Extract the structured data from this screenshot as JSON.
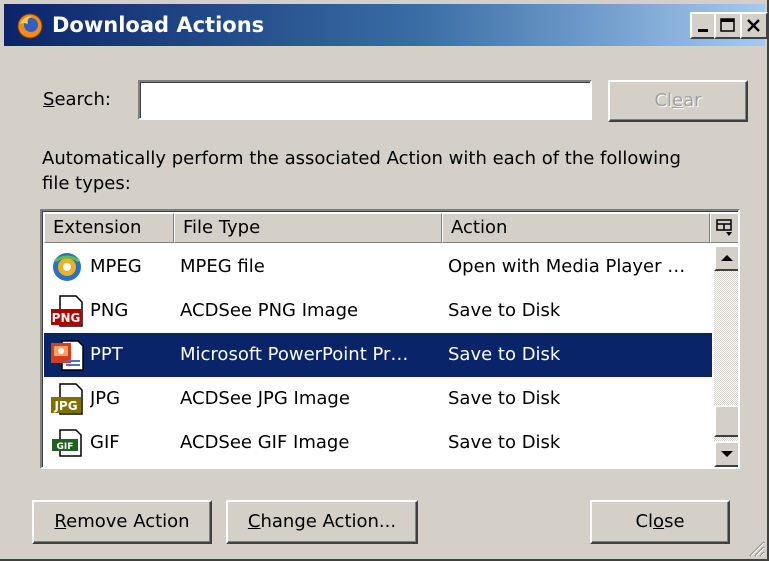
{
  "window": {
    "title": "Download Actions",
    "icon": "firefox-icon"
  },
  "title_buttons": {
    "minimize": "minimize-icon",
    "maximize": "maximize-icon",
    "close": "close-icon"
  },
  "search": {
    "label_accel": "S",
    "label_rest": "earch:",
    "value": "",
    "placeholder": "",
    "clear_pre": "Cl",
    "clear_accel": "e",
    "clear_post": "ar"
  },
  "description": {
    "line1": "Automatically perform the associated Action with each of the following",
    "line2": "file types:"
  },
  "table": {
    "columns": [
      "Extension",
      "File Type",
      "Action"
    ],
    "column_picker_icon": "column-picker-icon",
    "rows": [
      {
        "extension": "MPEG",
        "file_type": "MPEG file",
        "action": "Open with Media Player …",
        "icon": "media-player-icon",
        "selected": false
      },
      {
        "extension": "PNG",
        "file_type": "ACDSee PNG Image",
        "action": "Save to Disk",
        "icon": "png-file-icon",
        "selected": false
      },
      {
        "extension": "PPT",
        "file_type": "Microsoft PowerPoint Pr…",
        "action": "Save to Disk",
        "icon": "powerpoint-file-icon",
        "selected": true
      },
      {
        "extension": "JPG",
        "file_type": "ACDSee JPG Image",
        "action": "Save to Disk",
        "icon": "jpg-file-icon",
        "selected": false
      },
      {
        "extension": "GIF",
        "file_type": "ACDSee GIF Image",
        "action": "Save to Disk",
        "icon": "gif-file-icon",
        "selected": false
      }
    ]
  },
  "buttons": {
    "remove_accel": "R",
    "remove_rest": "emove Action",
    "change_accel": "C",
    "change_rest": "hange Action...",
    "close_pre": "Cl",
    "close_accel": "o",
    "close_post": "se"
  },
  "colors": {
    "selection": "#0a246a",
    "face": "#d4d0c8",
    "title_gradient_start": "#0a246a",
    "title_gradient_end": "#a6caf0"
  }
}
